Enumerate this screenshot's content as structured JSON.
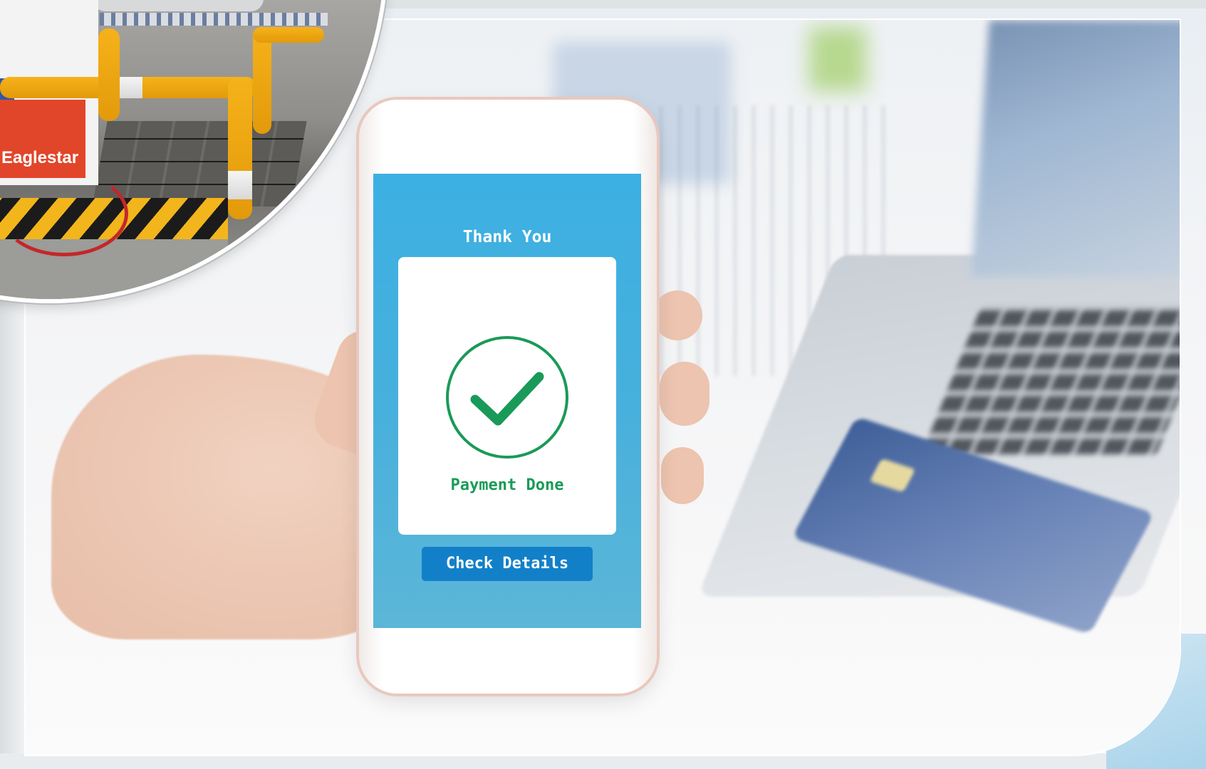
{
  "inset": {
    "sign_text": "Eaglestar"
  },
  "phone": {
    "heading": "Thank You",
    "status_text": "Payment Done",
    "button_label": "Check Details",
    "icon": "check-circle-icon"
  },
  "colors": {
    "screen_blue": "#3cb0e3",
    "button_blue": "#1280c8",
    "success_green": "#1a9a58"
  }
}
